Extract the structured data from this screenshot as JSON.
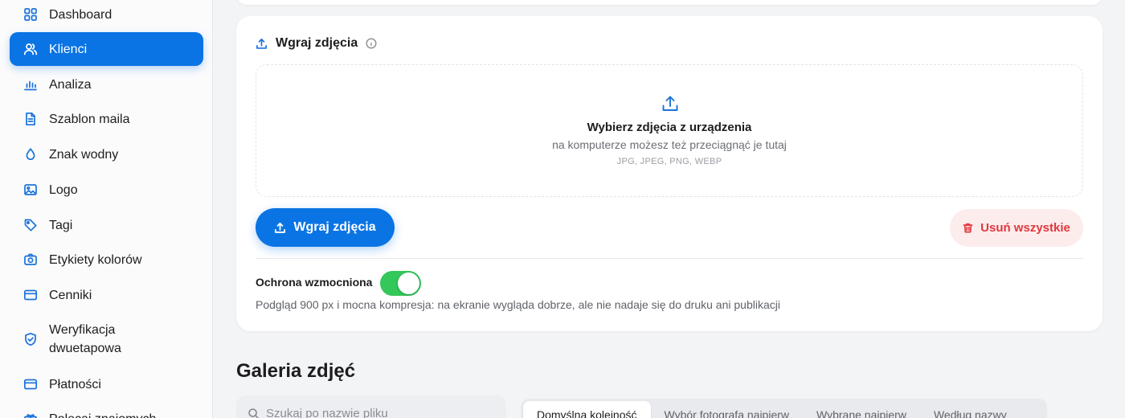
{
  "sidebar": {
    "items": [
      {
        "label": "Dashboard",
        "icon": "grid-icon"
      },
      {
        "label": "Klienci",
        "icon": "users-icon",
        "active": true
      },
      {
        "label": "Analiza",
        "icon": "bar-chart-icon"
      },
      {
        "label": "Szablon maila",
        "icon": "document-icon"
      },
      {
        "label": "Znak wodny",
        "icon": "droplet-icon"
      },
      {
        "label": "Logo",
        "icon": "image-icon"
      },
      {
        "label": "Tagi",
        "icon": "tag-icon"
      },
      {
        "label": "Etykiety kolorów",
        "icon": "camera-icon"
      },
      {
        "label": "Cenniki",
        "icon": "card-icon"
      },
      {
        "label": "Weryfikacja dwuetapowa",
        "icon": "shield-icon"
      },
      {
        "label": "Płatności",
        "icon": "card-icon"
      },
      {
        "label": "Polecaj znajomych",
        "icon": "gift-icon"
      }
    ]
  },
  "upload": {
    "title": "Wgraj zdjęcia",
    "dropzone": {
      "title": "Wybierz zdjęcia z urządzenia",
      "subtitle": "na komputerze możesz też przeciągnąć je tutaj",
      "formats": "JPG, JPEG, PNG, WEBP"
    },
    "upload_button": "Wgraj zdjęcia",
    "delete_button": "Usuń wszystkie",
    "protection": {
      "label": "Ochrona wzmocniona",
      "enabled": true,
      "description": "Podgląd 900 px i mocna kompresja: na ekranie wygląda dobrze, ale nie nadaje się do druku ani publikacji"
    }
  },
  "gallery": {
    "title": "Galeria zdjęć",
    "search_placeholder": "Szukaj po nazwie pliku",
    "sort_options": [
      "Domyślna kolejność",
      "Wybór fotografa najpierw",
      "Wybrane najpierw",
      "Według nazwy"
    ],
    "sort_active": "Domyślna kolejność"
  },
  "colors": {
    "accent": "#0a74e4",
    "toggle_on": "#34c759",
    "danger": "#e0383e",
    "danger_bg": "#fdecec"
  }
}
